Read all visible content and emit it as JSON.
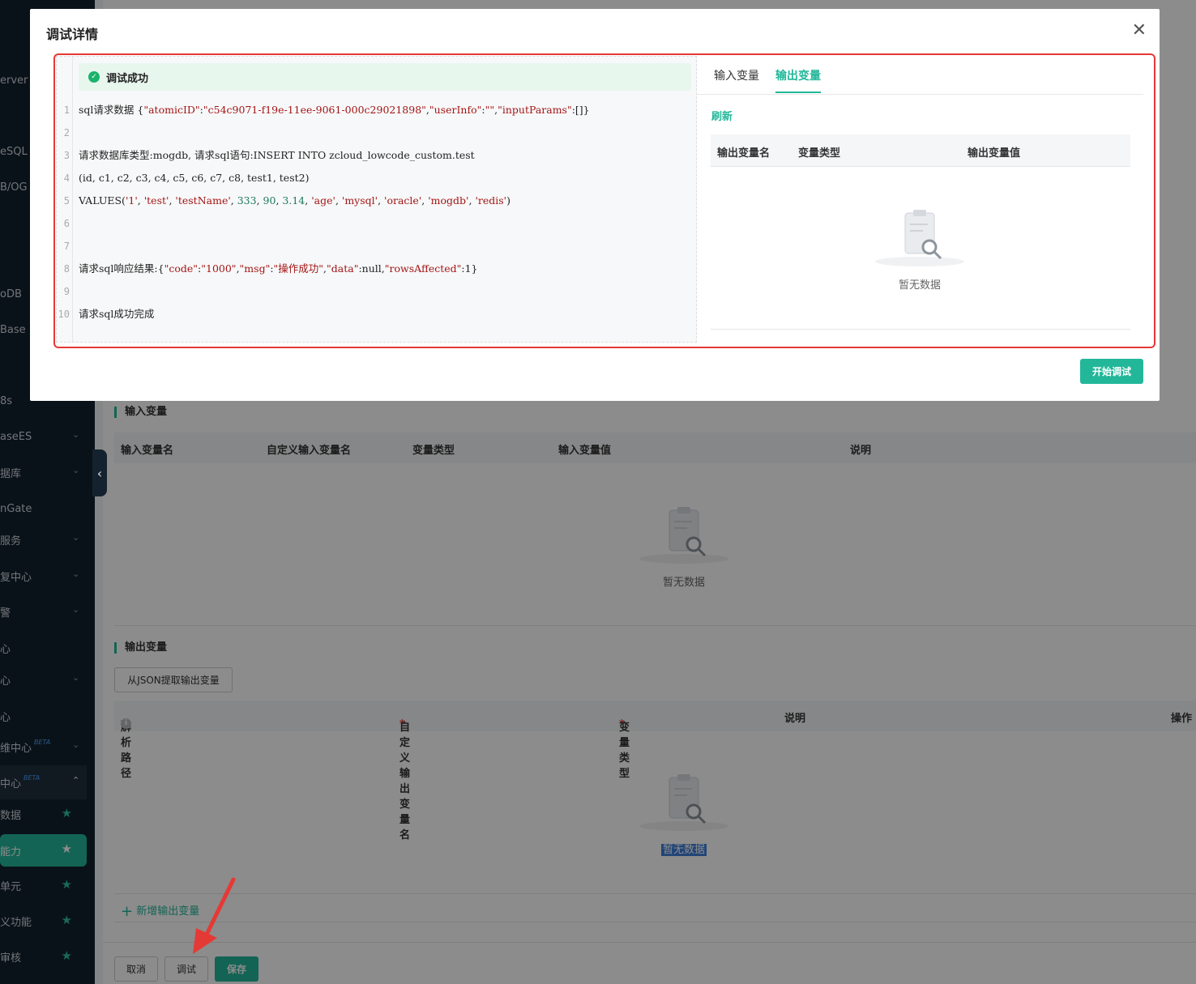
{
  "sidebar": {
    "items": [
      {
        "label": "erver",
        "chevron": false
      },
      {
        "label": "eSQL",
        "chevron": false
      },
      {
        "label": "B/OG",
        "chevron": false
      },
      {
        "label": "oDB",
        "chevron": false
      },
      {
        "label": "Base",
        "chevron": false
      },
      {
        "label": "8s",
        "chevron": false
      },
      {
        "label": "aseES",
        "chevron": true
      },
      {
        "label": "据库",
        "chevron": true
      },
      {
        "label": "nGate",
        "chevron": false
      },
      {
        "label": "服务",
        "chevron": true
      },
      {
        "label": "复中心",
        "chevron": true
      },
      {
        "label": "警",
        "chevron": true
      },
      {
        "label": "心",
        "chevron": false
      },
      {
        "label": "心",
        "chevron": true
      },
      {
        "label": "心",
        "chevron": false
      },
      {
        "label": "维中心",
        "beta": "BETA",
        "chevron": true
      },
      {
        "label": "中心",
        "beta": "BETA",
        "chevron_up": true
      },
      {
        "label": "数据",
        "star": true
      },
      {
        "label": "能力",
        "star": true,
        "active": true
      },
      {
        "label": "单元",
        "star": true
      },
      {
        "label": "义功能",
        "star": true
      },
      {
        "label": "审核",
        "star": true
      }
    ]
  },
  "page": {
    "input_section_title": "输入变量",
    "input_headers": [
      "输入变量名",
      "自定义输入变量名",
      "变量类型",
      "输入变量值",
      "说明"
    ],
    "input_empty": "暂无数据",
    "output_section_title": "输出变量",
    "extract_button": "从JSON提取输出变量",
    "output_headers": {
      "path": "解析路径",
      "custom_name": "自定义输出变量名",
      "type": "变量类型",
      "desc": "说明",
      "op": "操作"
    },
    "required_mark": "*",
    "output_empty": "暂无数据",
    "add_output": "新增输出变量",
    "cancel_button": "取消",
    "debug_button": "调试",
    "save_button": "保存"
  },
  "modal": {
    "title": "调试详情",
    "success_text": "调试成功",
    "code_lines": [
      {
        "n": "1",
        "segments": [
          {
            "t": "sql请求数据 {",
            "c": ""
          },
          {
            "t": "\"atomicID\"",
            "c": "str"
          },
          {
            "t": ":",
            "c": ""
          },
          {
            "t": "\"c54c9071-f19e-11ee-9061-000c29021898\"",
            "c": "str"
          },
          {
            "t": ",",
            "c": ""
          },
          {
            "t": "\"userInfo\"",
            "c": "str"
          },
          {
            "t": ":",
            "c": ""
          },
          {
            "t": "\"\"",
            "c": "str"
          },
          {
            "t": ",",
            "c": ""
          },
          {
            "t": "\"inputParams\"",
            "c": "str"
          },
          {
            "t": ":[]}",
            "c": ""
          }
        ]
      },
      {
        "n": "2",
        "segments": []
      },
      {
        "n": "3",
        "segments": [
          {
            "t": "请求数据库类型:mogdb, 请求sql语句:INSERT INTO zcloud_lowcode_custom.test",
            "c": ""
          }
        ]
      },
      {
        "n": "4",
        "segments": [
          {
            "t": "(id, c1, c2, c3, c4, c5, c6, c7, c8, test1, test2)",
            "c": ""
          }
        ]
      },
      {
        "n": "5",
        "segments": [
          {
            "t": "VALUES(",
            "c": ""
          },
          {
            "t": "'1'",
            "c": "str"
          },
          {
            "t": ", ",
            "c": ""
          },
          {
            "t": "'test'",
            "c": "str"
          },
          {
            "t": ", ",
            "c": ""
          },
          {
            "t": "'testName'",
            "c": "str"
          },
          {
            "t": ", ",
            "c": ""
          },
          {
            "t": "333",
            "c": "num"
          },
          {
            "t": ", ",
            "c": ""
          },
          {
            "t": "90",
            "c": "num"
          },
          {
            "t": ", ",
            "c": ""
          },
          {
            "t": "3.14",
            "c": "num"
          },
          {
            "t": ", ",
            "c": ""
          },
          {
            "t": "'age'",
            "c": "str"
          },
          {
            "t": ", ",
            "c": ""
          },
          {
            "t": "'mysql'",
            "c": "str"
          },
          {
            "t": ", ",
            "c": ""
          },
          {
            "t": "'oracle'",
            "c": "str"
          },
          {
            "t": ", ",
            "c": ""
          },
          {
            "t": "'mogdb'",
            "c": "str"
          },
          {
            "t": ", ",
            "c": ""
          },
          {
            "t": "'redis'",
            "c": "str"
          },
          {
            "t": ")",
            "c": ""
          }
        ]
      },
      {
        "n": "6",
        "segments": []
      },
      {
        "n": "7",
        "segments": []
      },
      {
        "n": "8",
        "segments": [
          {
            "t": "请求sql响应结果:{",
            "c": ""
          },
          {
            "t": "\"code\"",
            "c": "str"
          },
          {
            "t": ":",
            "c": ""
          },
          {
            "t": "\"1000\"",
            "c": "str"
          },
          {
            "t": ",",
            "c": ""
          },
          {
            "t": "\"msg\"",
            "c": "str"
          },
          {
            "t": ":",
            "c": ""
          },
          {
            "t": "\"操作成功\"",
            "c": "str"
          },
          {
            "t": ",",
            "c": ""
          },
          {
            "t": "\"data\"",
            "c": "str"
          },
          {
            "t": ":null,",
            "c": ""
          },
          {
            "t": "\"rowsAffected\"",
            "c": "str"
          },
          {
            "t": ":1}",
            "c": ""
          }
        ]
      },
      {
        "n": "9",
        "segments": []
      },
      {
        "n": "10",
        "segments": [
          {
            "t": "请求sql成功完成",
            "c": ""
          }
        ]
      }
    ],
    "tabs": [
      "输入变量",
      "输出变量"
    ],
    "active_tab": "输出变量",
    "refresh": "刷新",
    "output_table_headers": [
      "输出变量名",
      "变量类型",
      "输出变量值"
    ],
    "empty_text": "暂无数据",
    "start_button": "开始调试",
    "close_icon": "close-icon"
  },
  "colors": {
    "accent": "#23b79a",
    "highlight_box": "#e53935",
    "success_bg": "#e8f7ee",
    "sidebar_bg": "#13222e"
  }
}
